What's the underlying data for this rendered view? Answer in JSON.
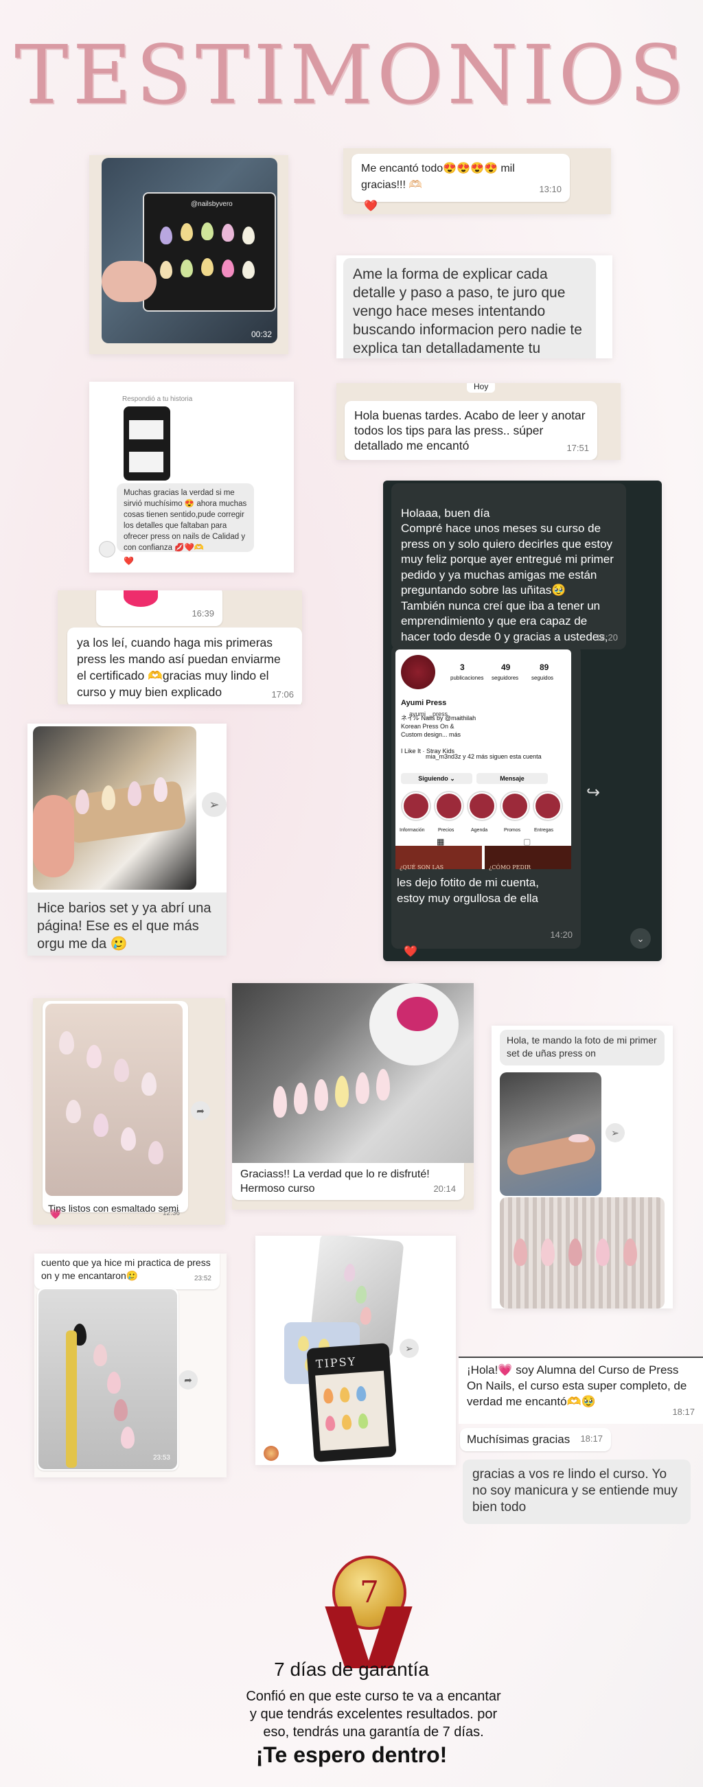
{
  "title": "TESTIMONIOS",
  "t1": {
    "timestamp": "00:32",
    "brand": "@nailsbyvero"
  },
  "t2": {
    "text": "Me encantó todo😍😍😍😍 mil gracias!!! 🫶🏻",
    "time": "13:10",
    "reaction": "❤️"
  },
  "t3": {
    "text": "Ame la forma de explicar cada detalle y paso a paso, te juro que vengo hace meses intentando buscando informacion pero nadie te explica tan detalladamente tu"
  },
  "t4": {
    "header": "Respondió a tu historia",
    "text": "Muchas gracias la verdad si me sirvió muchísimo 😍 ahora muchas cosas tienen sentido,pude corregir los detalles que faltaban para ofrecer  press on  nails de Calidad y con confianza 💋❤️🫶",
    "reaction": "❤️"
  },
  "t5": {
    "day": "Hoy",
    "text": "Hola buenas tardes. Acabo de leer y anotar todos los tips para las press.. súper detallado me encantó",
    "time": "17:51"
  },
  "t6": {
    "text1": "Holaaa, buen día\nCompré hace unos meses su curso de press on y solo quiero decirles que estoy muy feliz porque ayer entregué mi primer pedido y ya muchas amigas me están preguntando sobre las uñitas🥹\nTambién nunca creí que iba a tener un emprendimiento y que era capaz de hacer todo desde 0 y gracias a ustedes, este camino fue más fácil 😭❤️",
    "time1": "14:20",
    "profile": {
      "posts": "3",
      "posts_label": "publicaciones",
      "followers": "49",
      "followers_label": "seguidores",
      "following": "89",
      "following_label": "seguidos",
      "name": "Ayumi Press",
      "handle": "ayumi__press",
      "bio": "ネイル Nails by @maithilah\nKorean Press On &\nCustom design... más",
      "music": "I Like It · Stray Kids",
      "followed_by": "mia_m3nd3z y 42 más siguen esta cuenta",
      "follow_btn": "Siguiendo ⌄",
      "msg_btn": "Mensaje",
      "highlights": [
        "Información",
        "Precios",
        "Agenda",
        "Promos",
        "Entregas"
      ],
      "grid_labels": [
        "¿QUÉ SON LAS",
        "¿CÓMO PEDIR"
      ]
    },
    "text2": "les dejo fotito de mi cuenta, estoy muy orgullosa de ella",
    "time2": "14:20",
    "reaction": "❤️"
  },
  "t7": {
    "time_top": "16:39",
    "text": "ya los leí, cuando haga mis primeras press les mando así puedan enviarme el certificado 🫶gracias muy lindo el curso y muy bien explicado",
    "time": "17:06"
  },
  "t8": {
    "text": "Hice barios set y ya abrí una página! Ese es el que más orgu me da 🥲"
  },
  "t9": {
    "caption": "Tips listos con esmaltado semi",
    "time": "12:36",
    "reaction": "💗"
  },
  "t10": {
    "text": "Graciass!! La verdad que lo re disfruté! Hermoso curso",
    "time": "20:14"
  },
  "t11": {
    "text": "Hola, te mando la foto de mi primer set de uñas press on"
  },
  "t12": {
    "text": "cuento que ya hice mi practica de press on y me encantaron🥲",
    "time": "23:52",
    "photo_time": "23:53"
  },
  "t13": {
    "box_label": "TIPSY"
  },
  "t14": {
    "text1": "¡Hola!💗 soy Alumna del Curso de Press On Nails, el curso esta super completo, de verdad me encantó🫶🥹",
    "time1": "18:17",
    "text2": "Muchísimas gracias",
    "time2": "18:17",
    "text3": "gracias a vos re lindo el curso. Yo no soy manicura y se entiende muy bien todo"
  },
  "guarantee": {
    "number": "7",
    "heading": "7 días de garantía",
    "body": "Confió en que este curso te va a encantar y que tendrás excelentes resultados. por eso, tendrás una garantía de 7 días.",
    "cta": "¡Te espero dentro!"
  },
  "colors": {
    "accent": "#d99aa3",
    "wa_bg": "#efe7dd",
    "dark": "#1f2a2a",
    "heart": "#e0304a",
    "medal_red": "#a5141d"
  },
  "icons": [
    "forward-icon",
    "heart-icon",
    "send-icon",
    "check-icon"
  ]
}
